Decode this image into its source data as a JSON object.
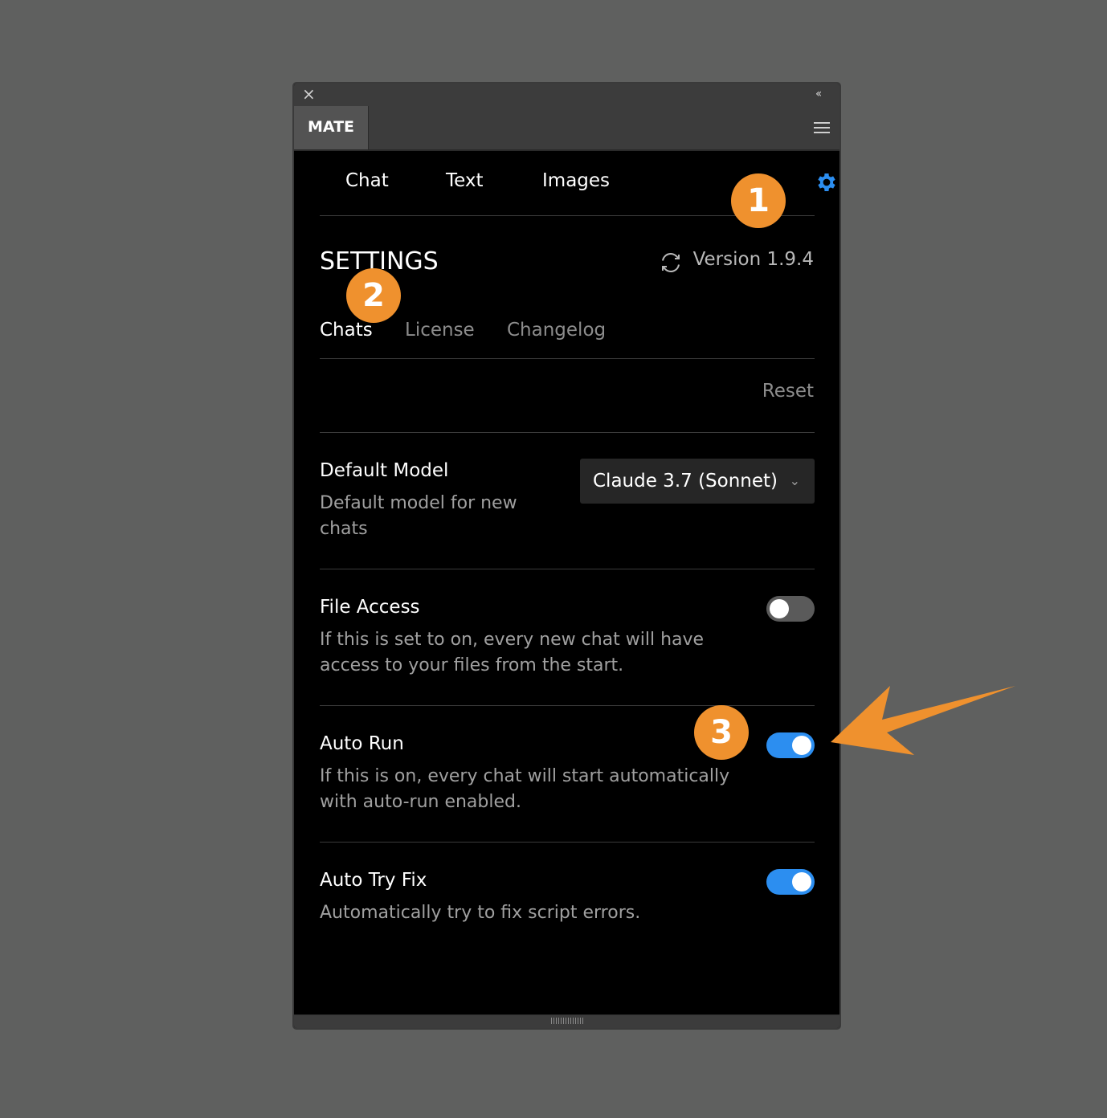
{
  "panel": {
    "tab_label": "MATE"
  },
  "nav": {
    "items": [
      {
        "label": "Chat"
      },
      {
        "label": "Text"
      },
      {
        "label": "Images"
      }
    ]
  },
  "annotations": {
    "badge_1": "1",
    "badge_2": "2",
    "badge_3": "3",
    "accent_color": "#ef912e"
  },
  "settings": {
    "title": "SETTINGS",
    "version": "Version 1.9.4",
    "tabs": [
      {
        "label": "Chats",
        "active": true
      },
      {
        "label": "License",
        "active": false
      },
      {
        "label": "Changelog",
        "active": false
      }
    ],
    "reset_label": "Reset",
    "rows": {
      "default_model": {
        "title": "Default Model",
        "desc_line1": "Default model for new",
        "desc_line2": "chats",
        "selected": "Claude 3.7 (Sonnet)"
      },
      "file_access": {
        "title": "File Access",
        "desc_line1": "If this is set to on, every new chat will have",
        "desc_line2": "access to your files from the start.",
        "enabled": false
      },
      "auto_run": {
        "title": "Auto Run",
        "desc_line1": "If this is on, every chat will start automatically",
        "desc_line2": "with auto-run enabled.",
        "enabled": true
      },
      "auto_try_fix": {
        "title": "Auto Try Fix",
        "desc_line1": "Automatically try to fix script errors.",
        "enabled": true
      }
    }
  },
  "colors": {
    "toggle_on": "#2c8ef0",
    "gear": "#2c8ef0"
  }
}
